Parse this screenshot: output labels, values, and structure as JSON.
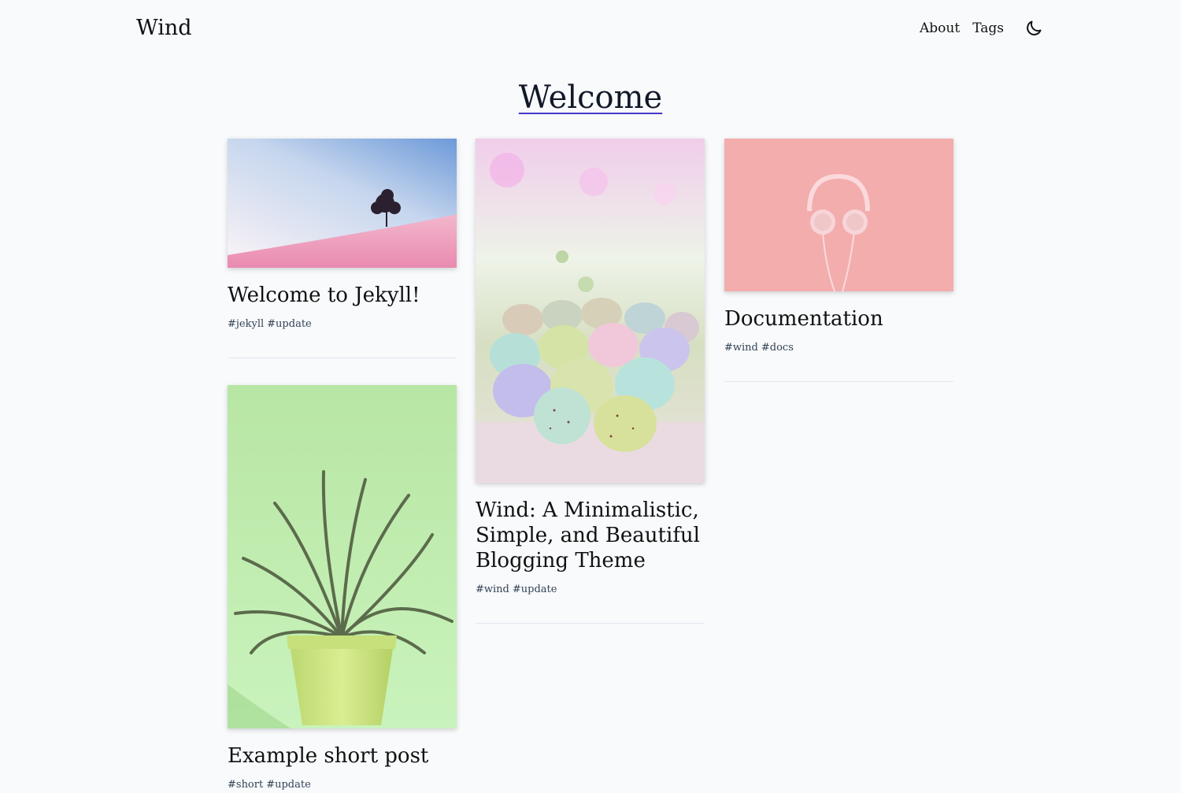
{
  "site": {
    "title": "Wind"
  },
  "nav": {
    "about": "About",
    "tags": "Tags",
    "theme_icon": "moon-icon"
  },
  "page": {
    "title": "Welcome"
  },
  "posts": [
    {
      "title": "Welcome to Jekyll!",
      "tags": [
        "#jekyll",
        "#update"
      ],
      "image": "pink-hill-tree"
    },
    {
      "title": "Wind: A Minimalistic, Simple, and Beautiful Blogging Theme",
      "tags": [
        "#wind",
        "#update"
      ],
      "image": "pastel-eggs"
    },
    {
      "title": "Documentation",
      "tags": [
        "#wind",
        "#docs"
      ],
      "image": "pink-headphones"
    },
    {
      "title": "Example short post",
      "tags": [
        "#short",
        "#update"
      ],
      "image": "green-air-plant"
    }
  ],
  "colors": {
    "background": "#f8fafc",
    "underline": "#4338ca",
    "separator": "#e2e8f0"
  }
}
